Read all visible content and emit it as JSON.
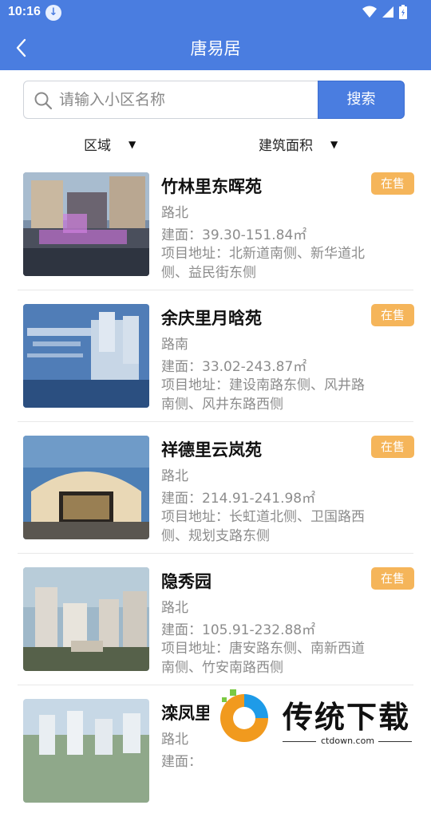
{
  "status_bar": {
    "time": "10:16"
  },
  "header": {
    "title": "唐易居"
  },
  "search": {
    "placeholder": "请输入小区名称",
    "button_label": "搜索"
  },
  "filters": [
    {
      "label": "区域"
    },
    {
      "label": "建筑面积"
    }
  ],
  "listings": [
    {
      "name": "竹林里东晖苑",
      "road": "路北",
      "area": "建面：39.30-151.84㎡",
      "address": "项目地址：北新道南侧、新华道北侧、益民街东侧",
      "badge": "在售"
    },
    {
      "name": "余庆里月晗苑",
      "road": "路南",
      "area": "建面：33.02-243.87㎡",
      "address": "项目地址：建设南路东侧、风井路南侧、风井东路西侧",
      "badge": "在售"
    },
    {
      "name": "祥德里云岚苑",
      "road": "路北",
      "area": "建面：214.91-241.98㎡",
      "address": "项目地址：长虹道北侧、卫国路西侧、规划支路东侧",
      "badge": "在售"
    },
    {
      "name": "隐秀园",
      "road": "路北",
      "area": "建面：105.91-232.88㎡",
      "address": "项目地址：唐安路东侧、南新西道南侧、竹安南路西侧",
      "badge": "在售"
    },
    {
      "name": "滦凤里",
      "road": "路北",
      "area": "建面：",
      "address": "",
      "badge": ""
    }
  ],
  "watermark": {
    "text": "传统下载",
    "url": "ctdown.com"
  },
  "colors": {
    "primary": "#4a7de0",
    "badge": "#f5b55a",
    "muted": "#8c8c8c"
  }
}
